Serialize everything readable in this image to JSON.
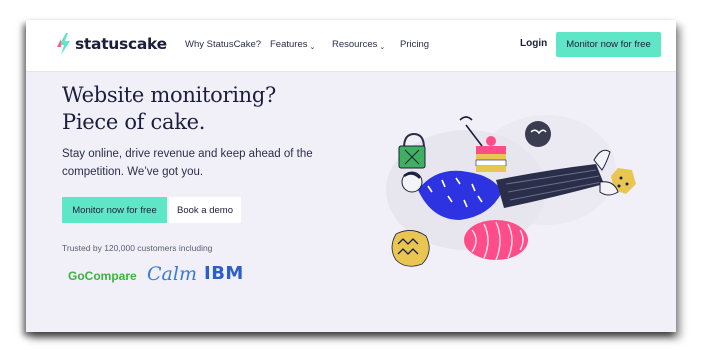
{
  "brand": {
    "name": "statuscake",
    "accent": "#5fe6c7",
    "logo_icon": "lightning-icon"
  },
  "nav": {
    "links": [
      {
        "label": "Why StatusCake?",
        "has_dropdown": false
      },
      {
        "label": "Features",
        "has_dropdown": true
      },
      {
        "label": "Resources",
        "has_dropdown": true
      },
      {
        "label": "Pricing",
        "has_dropdown": false
      }
    ],
    "login_label": "Login",
    "cta_label": "Monitor now for free"
  },
  "hero": {
    "title_line1": "Website monitoring?",
    "title_line2": "Piece of cake.",
    "subtitle": "Stay online, drive revenue and keep ahead of the competition. We’ve got you.",
    "primary_button": "Monitor now for free",
    "secondary_button": "Book a demo",
    "trusted_text": "Trusted by 120,000 customers including"
  },
  "customers": [
    {
      "name": "GoCompare",
      "color": "#3db23d"
    },
    {
      "name": "Calm",
      "color": "#3a7bd5"
    },
    {
      "name": "IBM",
      "color": "#2b5fc7"
    }
  ]
}
